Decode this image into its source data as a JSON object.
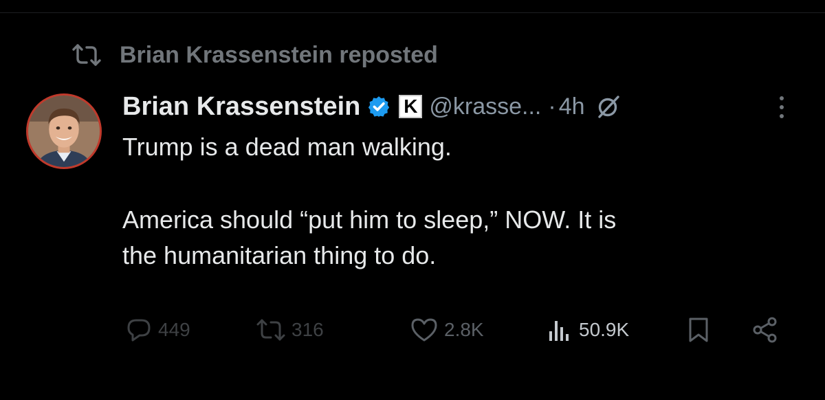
{
  "repost": {
    "icon": "repost-icon",
    "text": "Brian Krassenstein reposted"
  },
  "tweet": {
    "author_name": "Brian Krassenstein",
    "verified_icon": "verified-badge-icon",
    "affiliate_badge": "K",
    "handle": "@krasse...",
    "separator": "·",
    "time": "4h",
    "grok_icon": "grok-icon",
    "more_icon": "more-dots-icon",
    "text_lines": [
      "Trump is a dead man walking.",
      "America should “put him to sleep,” NOW.  It is",
      "the humanitarian thing to do."
    ]
  },
  "actions": {
    "replies": "449",
    "reposts": "316",
    "likes": "2.8K",
    "views": "50.9K"
  },
  "colors": {
    "background": "#000000",
    "text_primary": "#e7e9ea",
    "text_secondary": "#71767b",
    "verified": "#1d9bf0",
    "avatar_ring": "#c0392b"
  }
}
